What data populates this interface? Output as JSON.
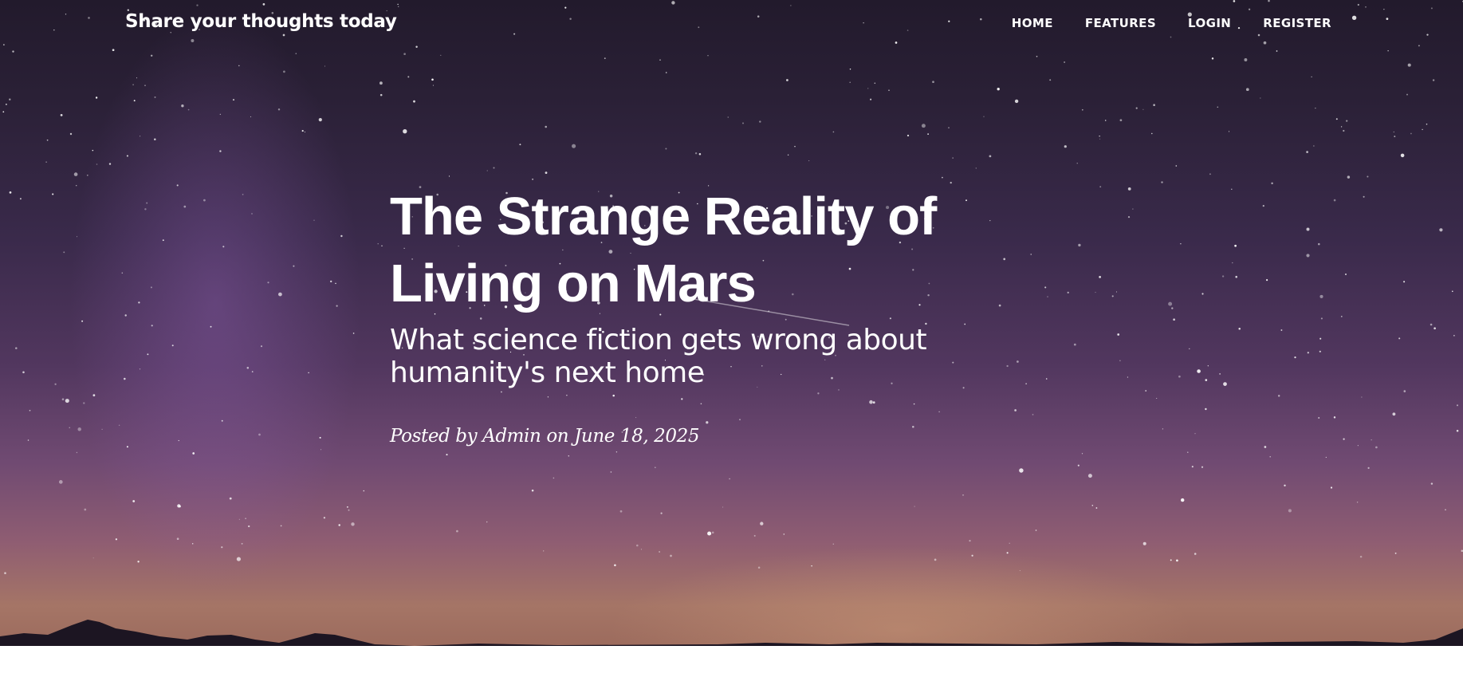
{
  "navbar": {
    "brand": "Share your thoughts today",
    "links": [
      {
        "label": "HOME"
      },
      {
        "label": "FEATURES"
      },
      {
        "label": "LOGIN"
      },
      {
        "label": "REGISTER"
      }
    ]
  },
  "post": {
    "title": "The Strange Reality of Living on Mars",
    "subtitle": "What science fiction gets wrong about humanity's next home",
    "meta": "Posted by Admin on June 18, 2025"
  },
  "colors": {
    "text": "#ffffff",
    "sky_top": "#221a2c",
    "sky_bottom": "#a57566",
    "page_background": "#ffffff"
  }
}
